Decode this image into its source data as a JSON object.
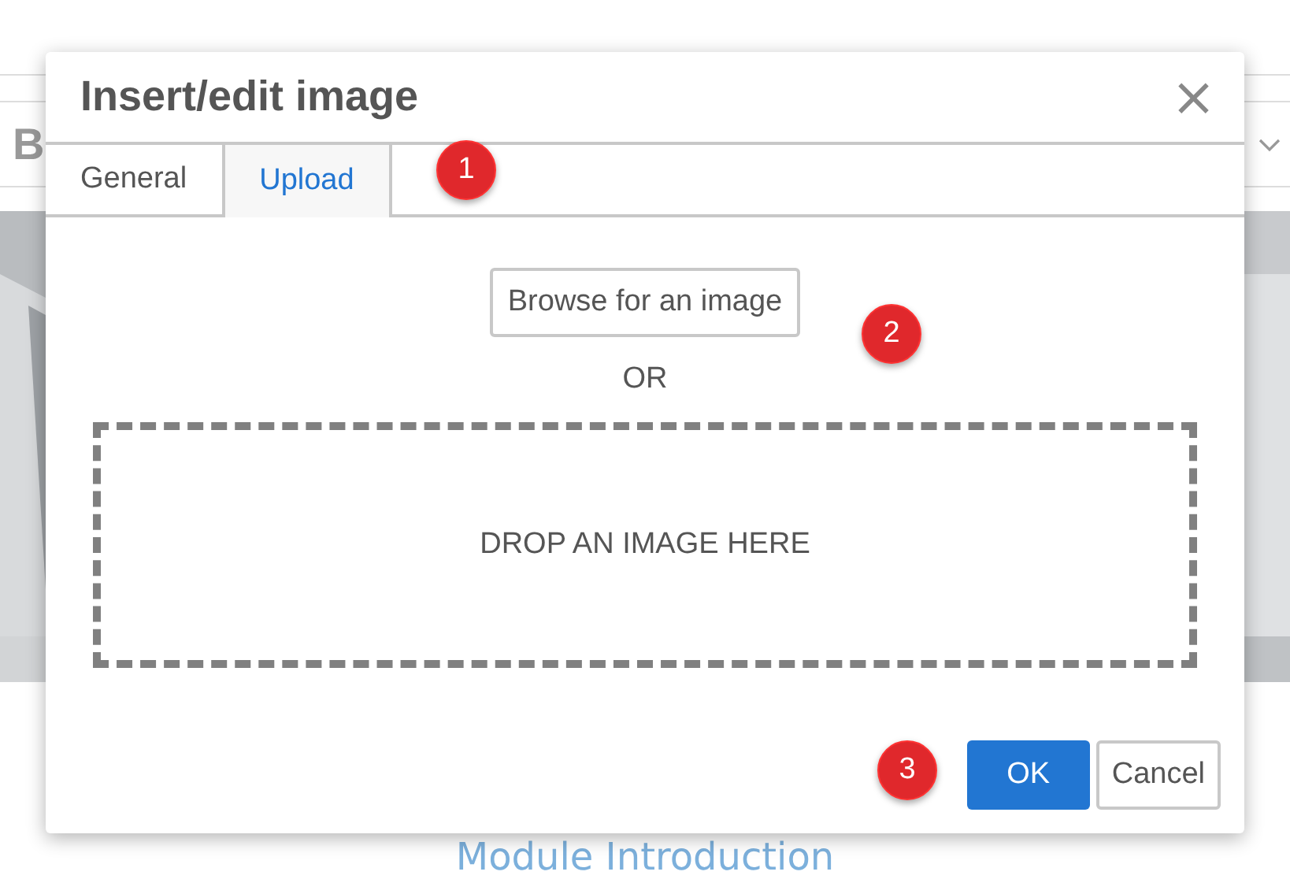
{
  "editor": {
    "toolbar_button": "B",
    "heading": "Module Introduction"
  },
  "dialog": {
    "title": "Insert/edit image",
    "close": "×",
    "tabs": [
      {
        "label": "General",
        "selected": false
      },
      {
        "label": "Upload",
        "selected": true
      }
    ],
    "browse_button": "Browse for an image",
    "separator": "OR",
    "drop_zone": "DROP AN IMAGE HERE",
    "buttons": [
      {
        "label": "OK",
        "kind": "primary"
      },
      {
        "label": "Cancel",
        "kind": "secondary"
      }
    ]
  },
  "callouts": [
    {
      "number": "1"
    },
    {
      "number": "2"
    },
    {
      "number": "3"
    }
  ]
}
